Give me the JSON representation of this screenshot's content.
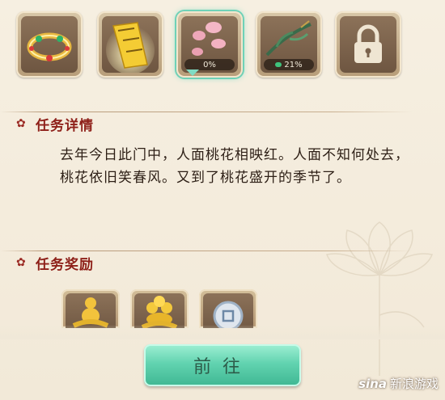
{
  "slots": [
    {
      "icon": "gold-bracelet-icon",
      "progress": ""
    },
    {
      "icon": "golden-scroll-icon",
      "progress": ""
    },
    {
      "icon": "peach-petals-icon",
      "progress": "0%",
      "progress_value": 0
    },
    {
      "icon": "jade-branch-icon",
      "progress": "21%",
      "progress_value": 21
    },
    {
      "icon": "lock-icon",
      "progress": ""
    }
  ],
  "task_detail": {
    "title": "任务详情",
    "text": "去年今日此门中，人面桃花相映红。人面不知何处去，桃花依旧笑春风。又到了桃花盛开的季节了。"
  },
  "task_reward": {
    "title": "任务奖励",
    "items": [
      {
        "icon": "gold-figurine-icon"
      },
      {
        "icon": "gold-coins-pile-icon"
      },
      {
        "icon": "silver-coin-icon"
      }
    ]
  },
  "go_button": {
    "label": "前往"
  },
  "watermark": {
    "logo": "sina",
    "text": "新浪游戏"
  },
  "colors": {
    "accent": "#62d3b0",
    "title": "#8e2019"
  }
}
